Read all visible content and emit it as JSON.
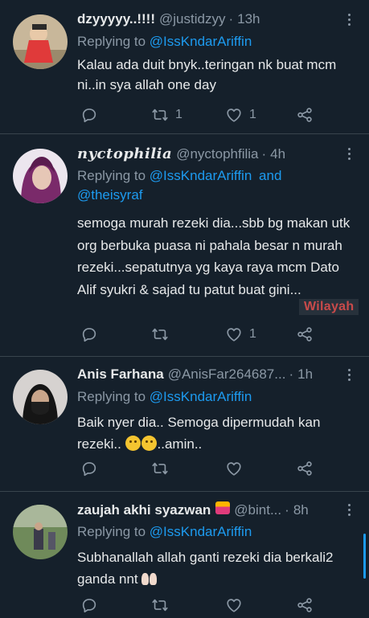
{
  "colors": {
    "background": "#15202b",
    "accent": "#1d9bf0",
    "muted": "#8b98a5",
    "text": "#e7e9ea",
    "divider": "#38444d"
  },
  "tweets": [
    {
      "name": "dzyyyyy..!!!!",
      "handle": "@justidzyy",
      "dot": "·",
      "time": "13h",
      "reply_prefix": "Replying to",
      "mention": "@IssKndarAriffin",
      "mention_and": "",
      "mention2": "",
      "text": "Kalau ada duit bnyk..teringan nk buat mcm ni..in sya allah one day",
      "retweets": "1",
      "likes": "1",
      "replies": ""
    },
    {
      "name": "nyctophilia",
      "handle": "@nyctophfilia",
      "dot": "·",
      "time": "4h",
      "reply_prefix": "Replying to",
      "mention": "@IssKndarAriffin",
      "mention_and": "and",
      "mention2": "@theisyraf",
      "text": "semoga murah rezeki dia...sbb bg makan utk org berbuka puasa ni pahala besar n murah rezeki...sepatutnya yg kaya raya mcm Dato Alif syukri & sajad tu patut buat gini...",
      "retweets": "",
      "likes": "1",
      "replies": ""
    },
    {
      "name": "Anis Farhana",
      "handle": "@AnisFar264687...",
      "dot": "·",
      "time": "1h",
      "reply_prefix": "Replying to",
      "mention": "@IssKndarAriffin",
      "mention_and": "",
      "mention2": "",
      "text": "Baik nyer dia.. Semoga dipermudah kan rezeki..",
      "text_tail": "..amin..",
      "retweets": "",
      "likes": "",
      "replies": ""
    },
    {
      "name": "zaujah akhi syazwan",
      "handle": "@bint...",
      "dot": "·",
      "time": "8h",
      "reply_prefix": "Replying to",
      "mention": "@IssKndarAriffin",
      "mention_and": "",
      "mention2": "",
      "text": "Subhanallah allah ganti rezeki dia berkali2 ganda nnt",
      "retweets": "",
      "likes": "",
      "replies": ""
    }
  ],
  "watermark": "Wilayah",
  "icons": [
    "more-icon",
    "reply-icon",
    "retweet-icon",
    "like-icon",
    "share-icon",
    "smile-emoji-icon",
    "praying-hands-emoji-icon"
  ]
}
